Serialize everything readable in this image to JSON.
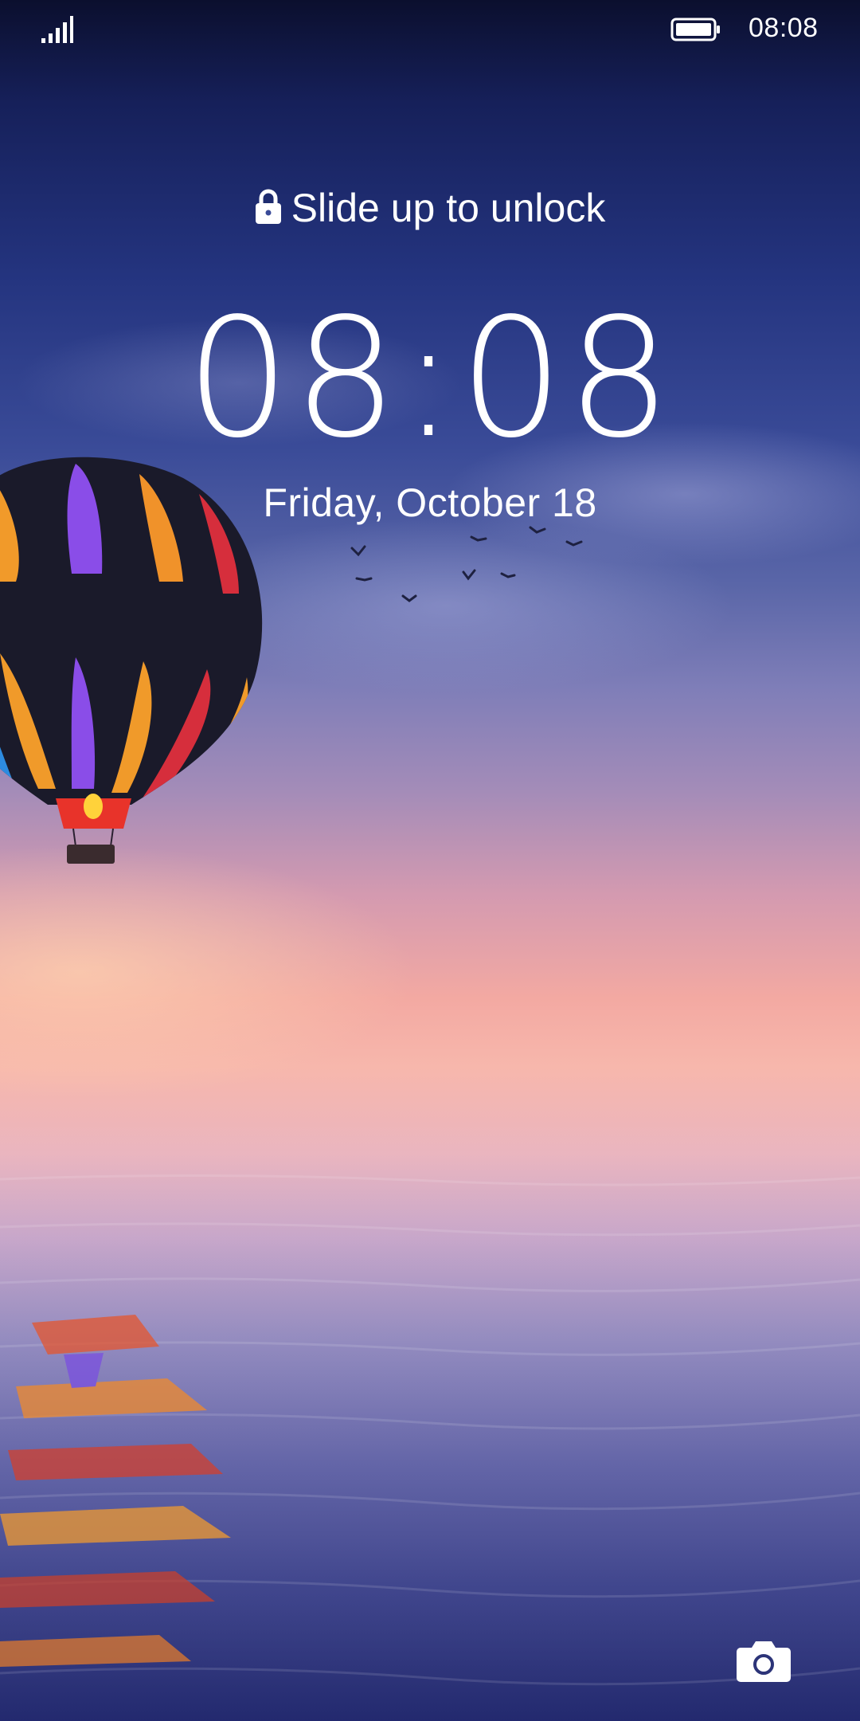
{
  "status_bar": {
    "time": "08:08",
    "signal_icon": "signal-bars-icon",
    "battery_icon": "battery-full-icon"
  },
  "lockscreen": {
    "hint_icon": "lock-icon",
    "hint_text": "Slide up to unlock",
    "clock": "08:08",
    "date": "Friday, October 18",
    "camera_icon": "camera-icon"
  },
  "colors": {
    "text": "#ffffff",
    "sky_top": "#0b0f2e",
    "sky_mid": "#3a4b98",
    "horizon": "#f7b7ac",
    "water": "#262d73"
  }
}
